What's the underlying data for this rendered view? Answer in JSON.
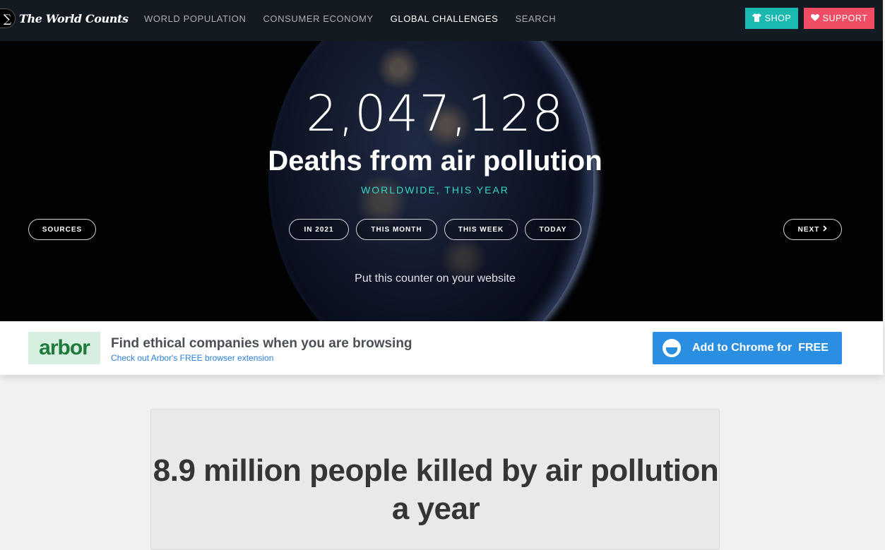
{
  "nav": {
    "logo_symbol": "∑",
    "logo_text": "The World Counts",
    "links": [
      "WORLD POPULATION",
      "CONSUMER ECONOMY",
      "GLOBAL CHALLENGES",
      "SEARCH"
    ],
    "active_link": "GLOBAL CHALLENGES",
    "shop_label": "SHOP",
    "support_label": "SUPPORT",
    "shop_color": "#1bb9b0",
    "support_color": "#ee4d63"
  },
  "hero": {
    "counter": "2,047,128",
    "title": "Deaths from air pollution",
    "subtitle": "WORLDWIDE, THIS YEAR",
    "sources_label": "SOURCES",
    "periods": [
      "IN 2021",
      "THIS MONTH",
      "THIS WEEK",
      "TODAY"
    ],
    "next_label": "NEXT",
    "put_counter": "Put this counter on your website",
    "accent_color": "#2fd6c8"
  },
  "arbor": {
    "logo_text": "arbor",
    "title": "Find ethical companies when you are browsing",
    "subtitle": "Check out Arbor's FREE browser extension",
    "button_label": "Add to Chrome for  FREE"
  },
  "card": {
    "title": "8.9 million people killed by air pollution a year"
  }
}
